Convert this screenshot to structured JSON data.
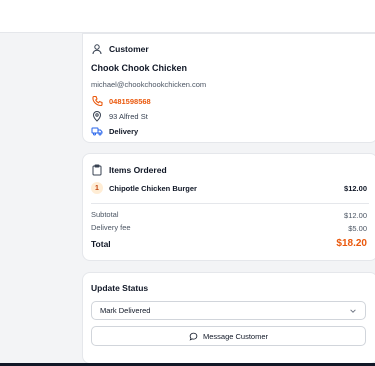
{
  "customer": {
    "title": "Customer",
    "name": "Chook Chook Chicken",
    "email": "michael@chookchookchicken.com",
    "phone": "0481598568",
    "address": "93 Alfred St",
    "delivery_type": "Delivery"
  },
  "items": {
    "title": "Items Ordered",
    "list": [
      {
        "qty": "1",
        "name": "Chipotle Chicken Burger",
        "price": "$12.00"
      }
    ],
    "subtotal_label": "Subtotal",
    "subtotal_value": "$12.00",
    "fee_label": "Delivery fee",
    "fee_value": "$5.00",
    "total_label": "Total",
    "total_value": "$18.20"
  },
  "status": {
    "title": "Update Status",
    "selected": "Mark Delivered",
    "message_button": "Message Customer"
  },
  "colors": {
    "accent": "#ea580c",
    "delivery_icon": "#2563eb"
  }
}
